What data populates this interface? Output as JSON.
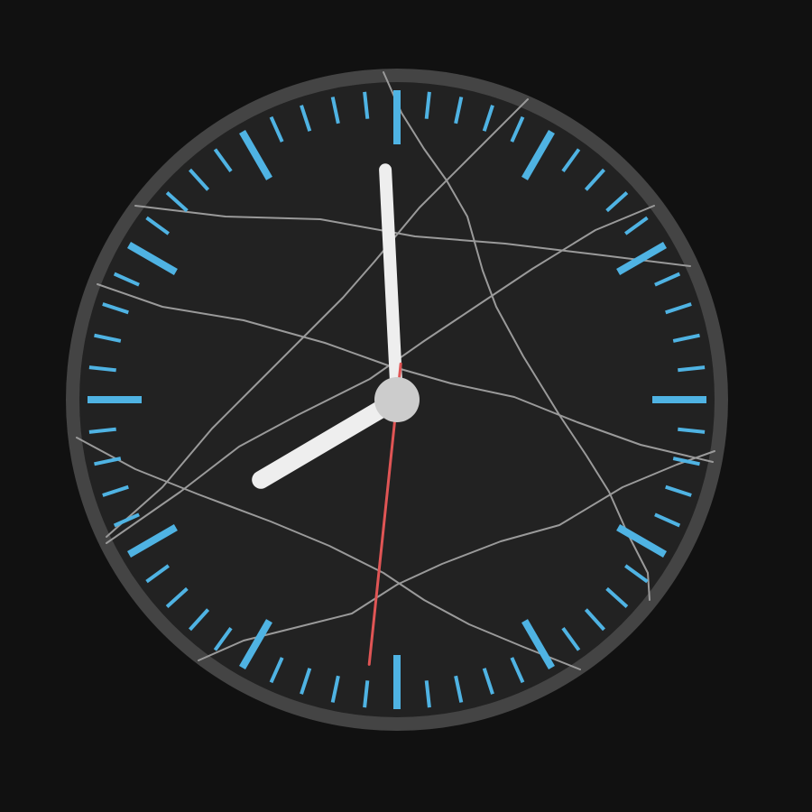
{
  "clock": {
    "time": {
      "hour": 7,
      "minute": 59,
      "second": 31
    },
    "minute_ticks": 60,
    "major_tick_every": 5
  },
  "colors": {
    "background": "#111111",
    "face": "#222222",
    "rim": "#444444",
    "tick": "#4fb3e3",
    "hour_hand": "#eeeeee",
    "minute_hand": "#eeeeee",
    "second_hand": "#e05555",
    "hub": "#cccccc",
    "crack": "#9a9a9a"
  }
}
